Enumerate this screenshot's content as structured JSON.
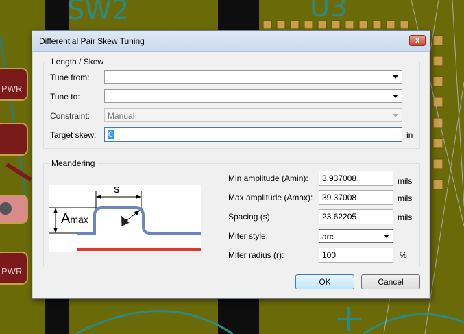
{
  "background": {
    "label_sw2": "SW2",
    "label_u3": "U3",
    "label_pwr1": "PWR",
    "label_pwr2": "PWR"
  },
  "dialog": {
    "title": "Differential Pair Skew Tuning",
    "close_glyph": "x"
  },
  "length_skew": {
    "title": "Length / Skew",
    "tune_from_label": "Tune from:",
    "tune_from_value": "",
    "tune_to_label": "Tune to:",
    "tune_to_value": "",
    "constraint_label": "Constraint:",
    "constraint_value": "Manual",
    "target_skew_label": "Target skew:",
    "target_skew_value": "0",
    "target_skew_unit": "in"
  },
  "meandering": {
    "title": "Meandering",
    "diagram": {
      "spacing_symbol": "s",
      "amplitude_symbol": "A",
      "amplitude_subscript": "max"
    },
    "min_amplitude_label": "Min amplitude (Amin):",
    "min_amplitude_value": "3.937008",
    "min_amplitude_unit": "mils",
    "max_amplitude_label": "Max amplitude (Amax):",
    "max_amplitude_value": "39.37008",
    "max_amplitude_unit": "mils",
    "spacing_label": "Spacing (s):",
    "spacing_value": "23.62205",
    "spacing_unit": "mils",
    "miter_style_label": "Miter style:",
    "miter_style_value": "arc",
    "miter_radius_label": "Miter radius (r):",
    "miter_radius_value": "100",
    "miter_radius_unit": "%"
  },
  "buttons": {
    "ok_label": "OK",
    "cancel_label": "Cancel"
  },
  "colors": {
    "board": "#6b6a08",
    "trace_blue": "#6b86bd",
    "trace_red": "#e0392b",
    "pad": "#7a1a1a"
  }
}
